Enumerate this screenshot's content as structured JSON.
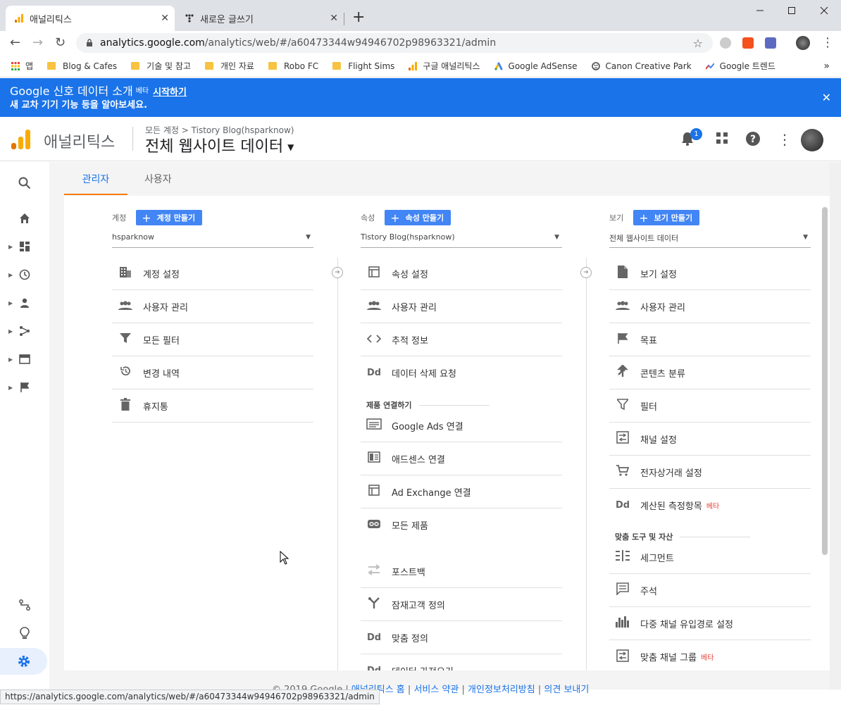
{
  "browser": {
    "tabs": [
      {
        "title": "애널리틱스",
        "close": "✕"
      },
      {
        "title": "새로운 글쓰기",
        "close": "✕"
      }
    ],
    "new_tab": "+",
    "url_host": "analytics.google.com",
    "url_path": "/analytics/web/#/a60473344w94946702p98963321/admin",
    "bookmarks": [
      "앱",
      "Blog & Cafes",
      "기술 및 참고",
      "개인 자료",
      "Robo FC",
      "Flight Sims",
      "구글 애널리틱스",
      "Google AdSense",
      "Canon Creative Park",
      "Google 트렌드"
    ],
    "bookmarks_more": "»"
  },
  "banner": {
    "title": "Google 신호 데이터 소개",
    "beta": "베타",
    "start": "시작하기",
    "subtitle": "새 교차 기기 기능 등을 알아보세요.",
    "close": "✕"
  },
  "header": {
    "app_title": "애널리틱스",
    "breadcrumb": "모든 계정 > Tistory Blog(hsparknow)",
    "view_title": "전체 웹사이트 데이터",
    "notification_count": "1"
  },
  "admin_tabs": [
    "관리자",
    "사용자"
  ],
  "columns": {
    "account": {
      "label": "계정",
      "create": "계정 만들기",
      "selected": "hsparknow",
      "items": [
        "계정 설정",
        "사용자 관리",
        "모든 필터",
        "변경 내역",
        "휴지통"
      ]
    },
    "property": {
      "label": "속성",
      "create": "속성 만들기",
      "selected": "Tistory Blog(hsparknow)",
      "items": [
        "속성 설정",
        "사용자 관리",
        "추적 정보",
        "데이터 삭제 요청"
      ],
      "section": "제품 연결하기",
      "link_items": [
        "Google Ads 연결",
        "애드센스 연결",
        "Ad Exchange 연결",
        "모든 제품"
      ],
      "more_items": [
        "포스트백",
        "잠재고객 정의",
        "맞춤 정의",
        "데이터 가져오기"
      ]
    },
    "view": {
      "label": "보기",
      "create": "보기 만들기",
      "selected": "전체 웹사이트 데이터",
      "items": [
        "보기 설정",
        "사용자 관리",
        "목표",
        "콘텐츠 분류",
        "필터",
        "채널 설정",
        "전자상거래 설정",
        "계산된 측정항목"
      ],
      "beta": "베타",
      "section": "맞춤 도구 및 자산",
      "tool_items": [
        "세그먼트",
        "주석",
        "다중 채널 유입경로 설정",
        "맞춤 채널 그룹"
      ]
    }
  },
  "footer": {
    "copyright": "© 2019 Google |",
    "links": [
      "애널리틱스 홈",
      "서비스 약관",
      "개인정보처리방침",
      "의견 보내기"
    ],
    "sep": "|"
  },
  "status_url": "https://analytics.google.com/analytics/web/#/a60473344w94946702p98963321/admin"
}
